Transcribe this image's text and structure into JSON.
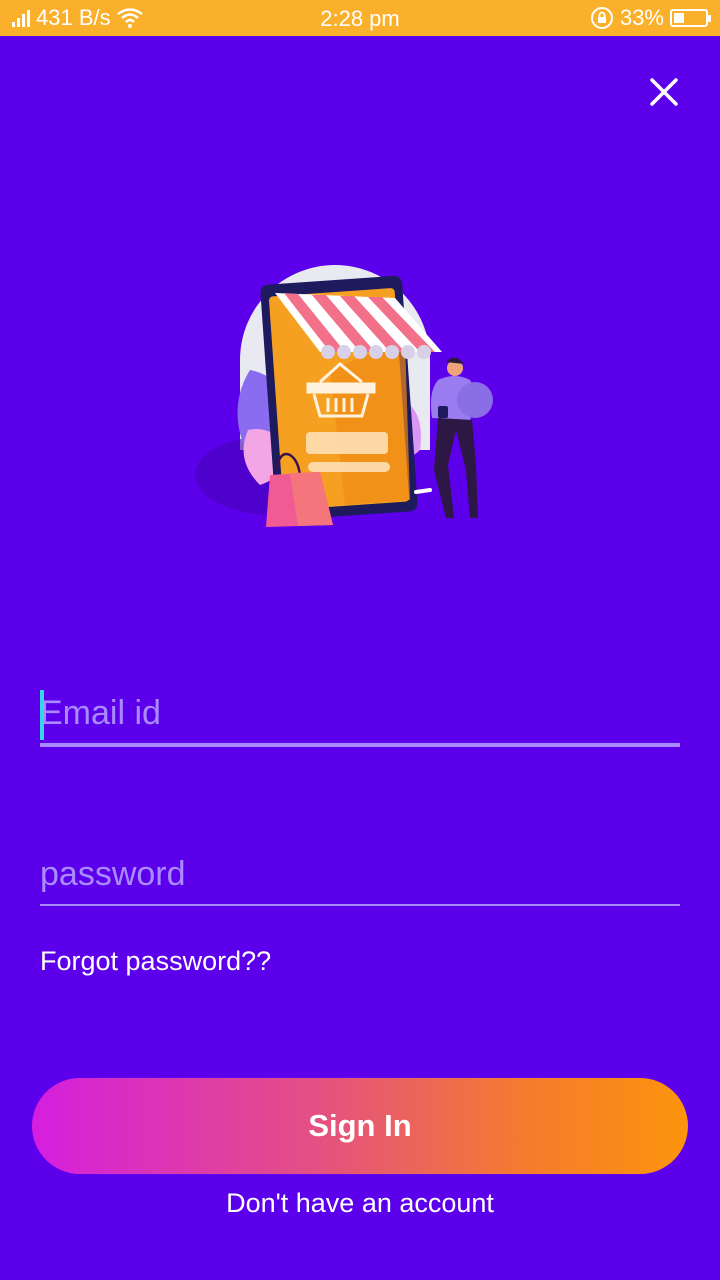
{
  "status_bar": {
    "network_speed": "431 B/s",
    "time": "2:28 pm",
    "battery_percent": "33%",
    "battery_level": 0.33,
    "icons": [
      "signal-icon",
      "wifi-icon",
      "rotation-lock-icon",
      "battery-icon"
    ]
  },
  "close": {
    "icon": "close-icon"
  },
  "illustration": {
    "name": "online-shopping-illustration"
  },
  "login_form": {
    "email_placeholder": "Email id",
    "email_value": "",
    "password_placeholder": "password",
    "password_value": "",
    "forgot_password_label": "Forgot password??"
  },
  "actions": {
    "sign_in_label": "Sign In",
    "no_account_label": "Don't have an account"
  },
  "colors": {
    "background": "#5c00eb",
    "status_bar": "#fbb02b",
    "button_gradient_start": "#d51ee0",
    "button_gradient_end": "#fc940c",
    "caret": "#34d6e8"
  }
}
